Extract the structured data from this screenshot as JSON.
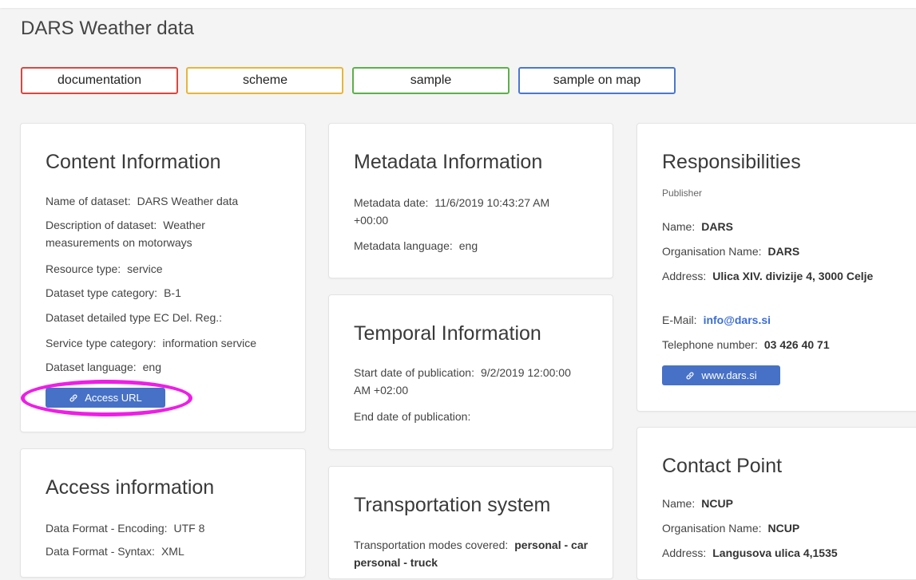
{
  "page": {
    "title": "DARS Weather data"
  },
  "tabs": [
    {
      "label": "documentation",
      "color": "#d9473f"
    },
    {
      "label": "scheme",
      "color": "#e8b53a"
    },
    {
      "label": "sample",
      "color": "#5db04a"
    },
    {
      "label": "sample on map",
      "color": "#4a78cf"
    }
  ],
  "content_info": {
    "title": "Content Information",
    "rows": [
      {
        "label": "Name of dataset:",
        "value": "DARS Weather data"
      },
      {
        "label": "Description of dataset:",
        "value": "Weather measurements on motorways"
      },
      {
        "label": "Resource type:",
        "value": "service"
      },
      {
        "label": "Dataset type category:",
        "value": "B-1"
      },
      {
        "label": "Dataset detailed type EC Del. Reg.:",
        "value": ""
      },
      {
        "label": "Service type category:",
        "value": "information service"
      },
      {
        "label": "Dataset language:",
        "value": "eng"
      }
    ],
    "access_button": "Access URL"
  },
  "access_info": {
    "title": "Access information",
    "rows": [
      {
        "label": "Data Format - Encoding:",
        "value": "UTF 8"
      },
      {
        "label": "Data Format - Syntax:",
        "value": "XML"
      }
    ]
  },
  "metadata_info": {
    "title": "Metadata Information",
    "rows": [
      {
        "label": "Metadata date:",
        "value": "11/6/2019 10:43:27 AM +00:00"
      },
      {
        "label": "Metadata language:",
        "value": "eng"
      }
    ]
  },
  "temporal_info": {
    "title": "Temporal Information",
    "rows": [
      {
        "label": "Start date of publication:",
        "value": "9/2/2019 12:00:00 AM +02:00"
      },
      {
        "label": "End date of publication:",
        "value": ""
      }
    ]
  },
  "transport": {
    "title": "Transportation system",
    "rows": [
      {
        "label": "Transportation modes covered:",
        "value": "personal - car personal - truck"
      }
    ]
  },
  "responsibilities": {
    "title": "Responsibilities",
    "subtitle": "Publisher",
    "rows": [
      {
        "label": "Name:",
        "value": "DARS"
      },
      {
        "label": "Organisation Name:",
        "value": "DARS"
      },
      {
        "label": "Address:",
        "value": "Ulica XIV. divizije 4, 3000 Celje"
      },
      {
        "label": "E-Mail:",
        "value": "info@dars.si"
      },
      {
        "label": "Telephone number:",
        "value": "03 426 40 71"
      }
    ],
    "website_button": "www.dars.si"
  },
  "contact_point": {
    "title": "Contact Point",
    "rows": [
      {
        "label": "Name:",
        "value": "NCUP"
      },
      {
        "label": "Organisation Name:",
        "value": "NCUP"
      },
      {
        "label": "Address:",
        "value": "Langusova ulica 4,1535"
      }
    ]
  },
  "highlight": {
    "color": "#ee1ee6"
  }
}
